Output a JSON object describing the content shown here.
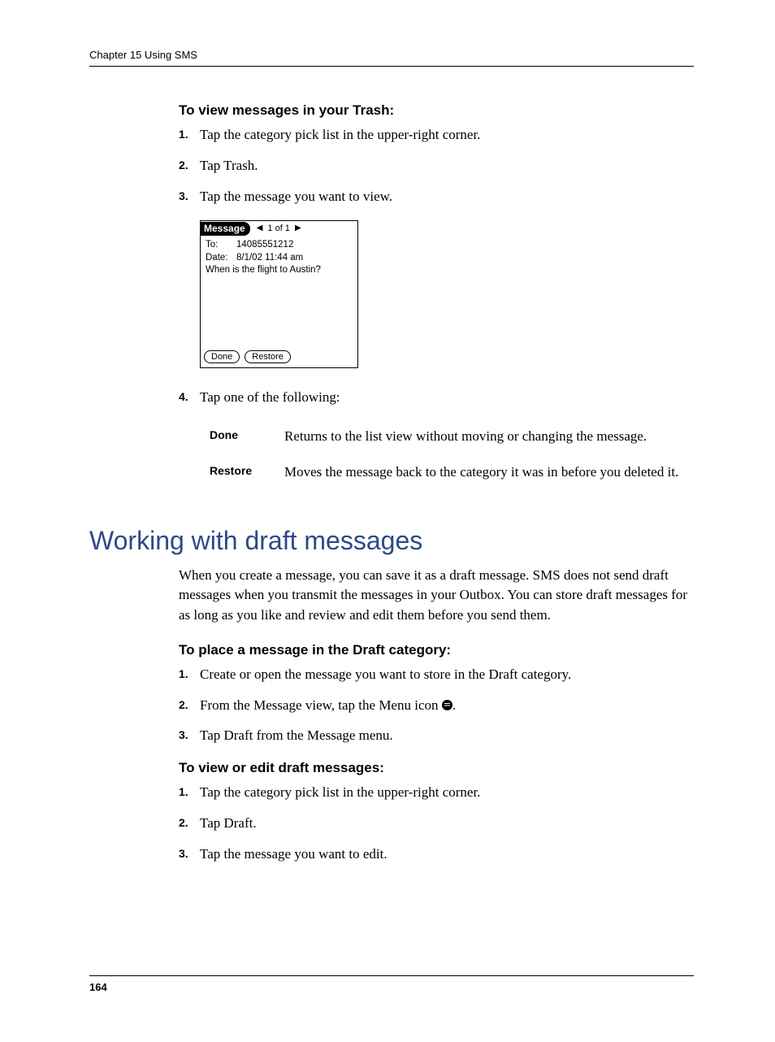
{
  "header": {
    "chapter_line": "Chapter 15   Using SMS"
  },
  "trash": {
    "heading": "To view messages in your Trash:",
    "steps": [
      "Tap the category pick list in the upper-right corner.",
      "Tap Trash.",
      "Tap the message you want to view."
    ],
    "step4": "Tap one of the following:"
  },
  "screenshot": {
    "title": "Message",
    "counter": "1 of 1",
    "to_label": "To:",
    "to_value": "14085551212",
    "date_label": "Date:",
    "date_value": "8/1/02 11:44 am",
    "body": "When is the flight to Austin?",
    "btn_done": "Done",
    "btn_restore": "Restore"
  },
  "defs": {
    "done": {
      "term": "Done",
      "desc": "Returns to the list view without moving or changing the message."
    },
    "restore": {
      "term": "Restore",
      "desc": "Moves the message back to the category it was in before you deleted it."
    }
  },
  "drafts": {
    "title": "Working with draft messages",
    "intro": "When you create a message, you can save it as a draft message. SMS does not send draft messages when you transmit the messages in your Outbox. You can store draft messages for as long as you like and review and edit them before you send them.",
    "place_heading": "To place a message in the Draft category:",
    "place_steps": {
      "s1": "Create or open the message you want to store in the Draft category.",
      "s2a": "From the Message view, tap the Menu icon ",
      "s2b": ".",
      "s3": "Tap Draft from the Message menu."
    },
    "view_heading": "To view or edit draft messages:",
    "view_steps": [
      "Tap the category pick list in the upper-right corner.",
      "Tap Draft.",
      "Tap the message you want to edit."
    ]
  },
  "footer": {
    "page_number": "164"
  }
}
